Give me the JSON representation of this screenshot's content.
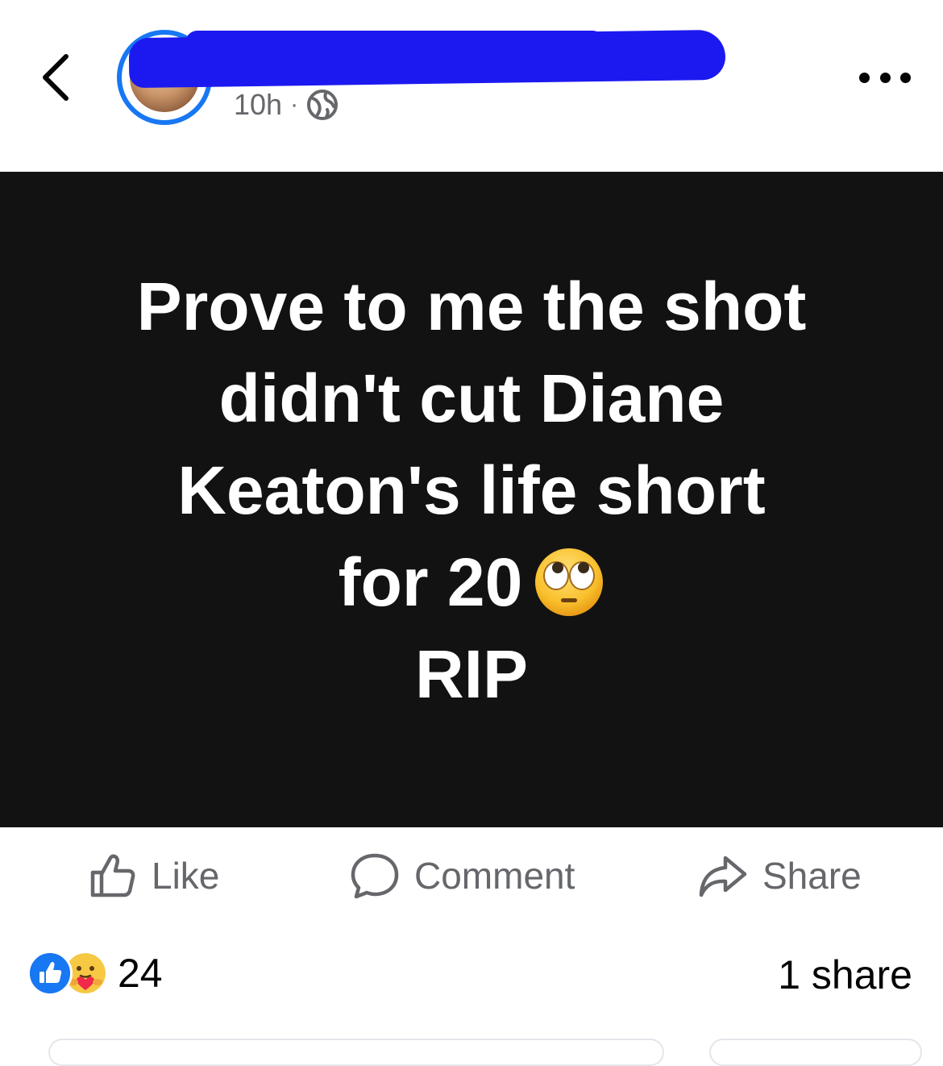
{
  "header": {
    "back_icon": "chevron-left-icon",
    "author_name": "",
    "timestamp": "10h",
    "separator": "·",
    "audience_icon": "globe-icon",
    "more_icon": "more-horizontal-icon"
  },
  "post": {
    "background_color": "#121212",
    "text_color": "#ffffff",
    "lines": [
      "Prove to me the shot",
      "didn't cut Diane",
      "Keaton's life short",
      "for 20",
      "RIP"
    ],
    "emoji": "face-with-rolling-eyes"
  },
  "actions": {
    "like_label": "Like",
    "comment_label": "Comment",
    "share_label": "Share"
  },
  "footer": {
    "reaction_icons": [
      "like-reaction-icon",
      "care-reaction-icon"
    ],
    "reaction_count": "24",
    "share_count": "1 share"
  },
  "colors": {
    "accent": "#1877f2",
    "secondary_text": "#65676b",
    "redaction": "#1c19f0"
  }
}
